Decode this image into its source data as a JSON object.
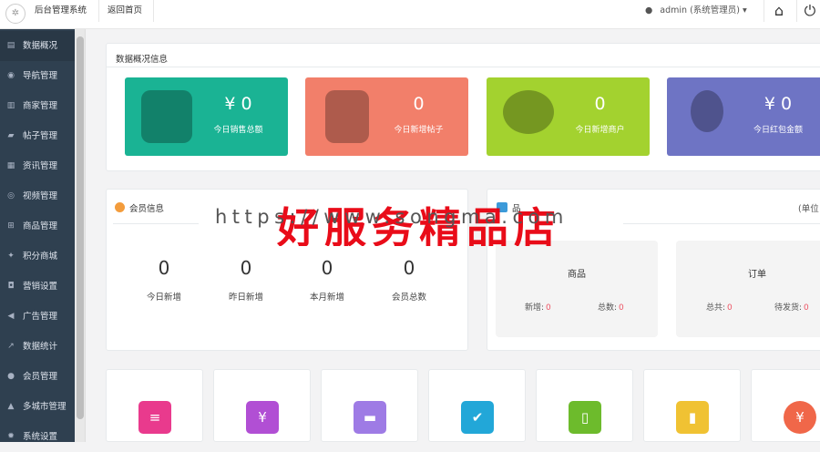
{
  "header": {
    "brand": "后台管理系统",
    "back_home": "返回首页",
    "user": "admin (系统管理员) ▾"
  },
  "sidebar": {
    "items": [
      {
        "label": "数据概况",
        "icon": "dashboard-icon"
      },
      {
        "label": "导航管理",
        "icon": "compass-icon"
      },
      {
        "label": "商家管理",
        "icon": "bank-icon"
      },
      {
        "label": "帖子管理",
        "icon": "comment-icon"
      },
      {
        "label": "资讯管理",
        "icon": "newspaper-icon"
      },
      {
        "label": "视频管理",
        "icon": "play-icon"
      },
      {
        "label": "商品管理",
        "icon": "cart-icon"
      },
      {
        "label": "积分商城",
        "icon": "trophy-icon"
      },
      {
        "label": "营销设置",
        "icon": "gift-icon"
      },
      {
        "label": "广告管理",
        "icon": "bullhorn-icon"
      },
      {
        "label": "数据统计",
        "icon": "chart-icon"
      },
      {
        "label": "会员管理",
        "icon": "user-icon"
      },
      {
        "label": "多城市管理",
        "icon": "graduation-icon"
      },
      {
        "label": "系统设置",
        "icon": "gear-icon"
      }
    ]
  },
  "overview": {
    "title": "数据概况信息",
    "stats": [
      {
        "value": "¥ 0",
        "label": "今日销售总额",
        "color": "#1ab394",
        "icon": "money-bag-icon"
      },
      {
        "value": "0",
        "label": "今日新增帖子",
        "color": "#f27f6a",
        "icon": "document-icon"
      },
      {
        "value": "0",
        "label": "今日新增商户",
        "color": "#a3d22f",
        "icon": "chat-bubble-icon"
      },
      {
        "value": "¥ 0",
        "label": "今日红包金额",
        "color": "#6e74c4",
        "icon": "paw-icon"
      }
    ]
  },
  "members": {
    "title": "会员信息",
    "stats": [
      {
        "value": "0",
        "label": "今日新增"
      },
      {
        "value": "0",
        "label": "昨日新增"
      },
      {
        "value": "0",
        "label": "本月新增"
      },
      {
        "value": "0",
        "label": "会员总数"
      }
    ]
  },
  "goods_panel": {
    "title": "品",
    "unit": "(单位",
    "boxes": [
      {
        "title": "商品",
        "k1": "新增:",
        "v1": "0",
        "k2": "总数:",
        "v2": "0"
      },
      {
        "title": "订单",
        "k1": "总共:",
        "v1": "0",
        "k2": "待发货:",
        "v2": "0"
      }
    ]
  },
  "watermark": {
    "url": "https://www.songma.com",
    "text": "好服务精品店"
  },
  "tiles": [
    {
      "color": "#e93a8d",
      "icon": "document-icon"
    },
    {
      "color": "#b14fd4",
      "icon": "money-bag-icon"
    },
    {
      "color": "#9e7be5",
      "icon": "truck-icon"
    },
    {
      "color": "#22a7d8",
      "icon": "clipboard-check-icon"
    },
    {
      "color": "#6dbb2c",
      "icon": "notebook-icon"
    },
    {
      "color": "#f0c233",
      "icon": "mobile-icon"
    },
    {
      "color": "#f06749",
      "icon": "coin-icon"
    }
  ]
}
